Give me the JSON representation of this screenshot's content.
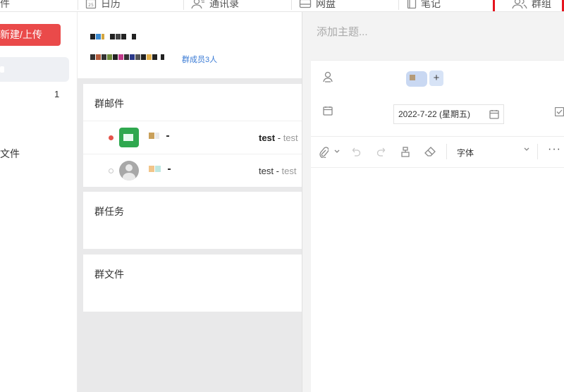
{
  "nav": {
    "mail_label": "邮件",
    "calendar_label": "日历",
    "contacts_label": "通讯录",
    "disk_label": "网盘",
    "notes_label": "笔记",
    "group_label": "群组"
  },
  "sidebar": {
    "new_upload_label": "新建/上传",
    "unread_count": "1",
    "file_item_label": "文件"
  },
  "group": {
    "members_link": "群成员3人",
    "mail_section_title": "群邮件",
    "task_section_title": "群任务",
    "file_section_title": "群文件",
    "mails": [
      {
        "unread": true,
        "subject": "test",
        "preview": "test"
      },
      {
        "unread": false,
        "subject": "test",
        "preview": "test"
      }
    ]
  },
  "compose": {
    "subject_placeholder": "添加主题...",
    "add_button": "+",
    "date_value": "2022-7-22 (星期五)",
    "font_label": "字体",
    "more_label": "···"
  },
  "colors": {
    "accent_red": "#ea4a4a",
    "link_blue": "#3a7bd5",
    "highlight_red": "#e5141e"
  }
}
